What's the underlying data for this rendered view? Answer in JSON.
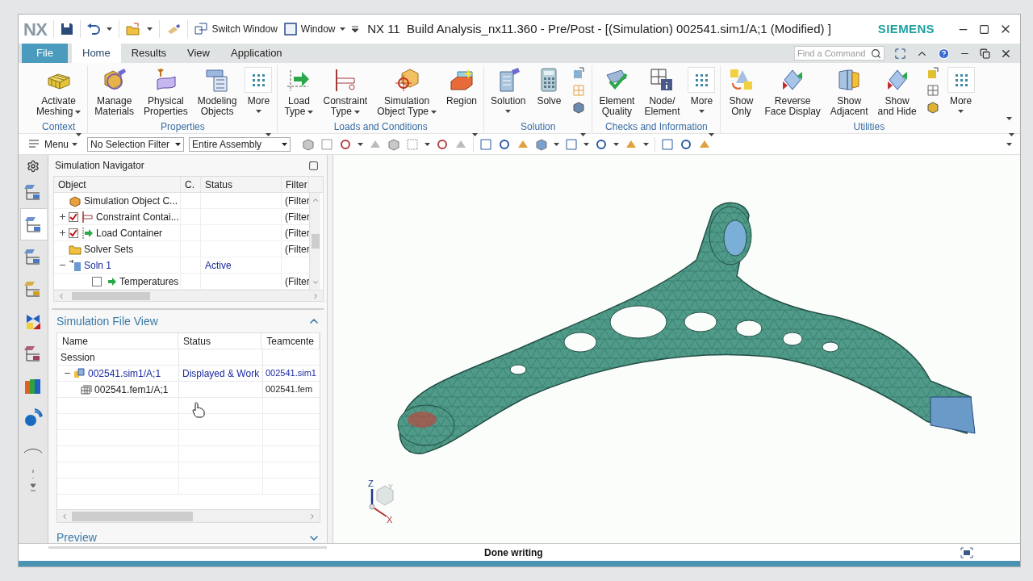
{
  "quick_access": {
    "logo": "NX",
    "buttons": [
      {
        "label": "Switch Window",
        "dropdown": false
      },
      {
        "label": "Window",
        "dropdown": true
      }
    ]
  },
  "window": {
    "title": "NX 11  Build Analysis_nx11.360 - Pre/Post - [(Simulation) 002541.sim1/A;1 (Modified) ]",
    "brand": "SIEMENS"
  },
  "tabs": [
    {
      "label": "File",
      "kind": "file",
      "selected": false
    },
    {
      "label": "Home",
      "kind": "tab",
      "selected": true
    },
    {
      "label": "Results",
      "kind": "tab",
      "selected": false
    },
    {
      "label": "View",
      "kind": "tab",
      "selected": false
    },
    {
      "label": "Application",
      "kind": "tab",
      "selected": false
    }
  ],
  "search": {
    "placeholder": "Find a Command"
  },
  "ribbon": [
    {
      "label": "Context",
      "items": [
        {
          "kind": "large",
          "lines": [
            "Activate",
            "Meshing"
          ],
          "dropdown": true
        }
      ]
    },
    {
      "label": "Properties",
      "items": [
        {
          "kind": "large",
          "lines": [
            "Manage",
            "Materials"
          ],
          "dropdown": false
        },
        {
          "kind": "large",
          "lines": [
            "Physical",
            "Properties"
          ],
          "dropdown": false
        },
        {
          "kind": "large",
          "lines": [
            "Modeling",
            "Objects"
          ],
          "dropdown": false
        },
        {
          "kind": "more",
          "lines": [
            "More"
          ],
          "dropdown": true
        }
      ]
    },
    {
      "label": "Loads and Conditions",
      "items": [
        {
          "kind": "large",
          "lines": [
            "Load",
            "Type"
          ],
          "dropdown": true
        },
        {
          "kind": "large",
          "lines": [
            "Constraint",
            "Type"
          ],
          "dropdown": true
        },
        {
          "kind": "large",
          "lines": [
            "Simulation",
            "Object Type"
          ],
          "dropdown": true
        },
        {
          "kind": "large",
          "lines": [
            "Region"
          ],
          "dropdown": false
        }
      ]
    },
    {
      "label": "Solution",
      "items": [
        {
          "kind": "large",
          "lines": [
            "Solution"
          ],
          "dropdown": true
        },
        {
          "kind": "large",
          "lines": [
            "Solve"
          ],
          "dropdown": false
        },
        {
          "kind": "small_stack"
        }
      ]
    },
    {
      "label": "Checks and Information",
      "items": [
        {
          "kind": "large",
          "lines": [
            "Element",
            "Quality"
          ],
          "dropdown": false
        },
        {
          "kind": "large",
          "lines": [
            "Node/",
            "Element"
          ],
          "dropdown": false
        },
        {
          "kind": "more",
          "lines": [
            "More"
          ],
          "dropdown": true
        }
      ]
    },
    {
      "label": "Utilities",
      "items": [
        {
          "kind": "large",
          "lines": [
            "Show",
            "Only"
          ],
          "dropdown": false
        },
        {
          "kind": "large",
          "lines": [
            "Reverse",
            "Face Display"
          ],
          "dropdown": false
        },
        {
          "kind": "large",
          "lines": [
            "Show",
            "Adjacent"
          ],
          "dropdown": false
        },
        {
          "kind": "large",
          "lines": [
            "Show",
            "and Hide"
          ],
          "dropdown": false
        },
        {
          "kind": "small_stack"
        },
        {
          "kind": "more",
          "lines": [
            "More"
          ],
          "dropdown": true
        }
      ]
    }
  ],
  "toolbar": {
    "menu": "Menu",
    "selection_filters": [
      {
        "value": "No Selection Filter"
      },
      {
        "value": "Entire Assembly"
      }
    ]
  },
  "resource_bar": [
    {
      "selected": false
    },
    {
      "selected": true
    },
    {
      "selected": false
    },
    {
      "selected": false
    },
    {
      "selected": false
    },
    {
      "selected": false
    },
    {
      "selected": false
    },
    {
      "selected": false
    },
    {
      "selected": false
    }
  ],
  "navigator": {
    "title": "Simulation Navigator",
    "columns": [
      "Object",
      "C.",
      "Status",
      "Filter"
    ],
    "rows": [
      {
        "label": "Simulation Object C...",
        "status": "",
        "filter": "(Filter",
        "expanded": null,
        "checked": null,
        "active": false
      },
      {
        "label": "Constraint Contai...",
        "status": "",
        "filter": "(Filter",
        "expanded": false,
        "checked": true,
        "active": false
      },
      {
        "label": "Load Container",
        "status": "",
        "filter": "(Filter",
        "expanded": false,
        "checked": true,
        "active": false
      },
      {
        "label": "Solver Sets",
        "status": "",
        "filter": "(Filter",
        "expanded": null,
        "checked": null,
        "active": false
      },
      {
        "label": "Soln 1",
        "status": "Active",
        "filter": "",
        "expanded": true,
        "checked": null,
        "active": true
      },
      {
        "label": "Temperatures",
        "status": "",
        "filter": "(Filter",
        "expanded": null,
        "checked": false,
        "active": false
      }
    ]
  },
  "file_view": {
    "title": "Simulation File View",
    "columns": [
      "Name",
      "Status",
      "Teamcente"
    ],
    "rows": [
      {
        "name": "Session",
        "children": [
          {
            "name": "002541.sim1/A;1",
            "status": "Displayed & Work",
            "teamcenter": "002541.sim1",
            "expanded": true,
            "current": true,
            "children": [
              {
                "name": "002541.fem1/A;1",
                "teamcenter": "002541.fem",
                "current": false
              }
            ]
          }
        ]
      }
    ]
  },
  "preview": {
    "title": "Preview"
  },
  "viewport": {
    "triad_labels": [
      "Z",
      "Y",
      "X"
    ]
  },
  "status_bar": {
    "message": "Done writing"
  }
}
